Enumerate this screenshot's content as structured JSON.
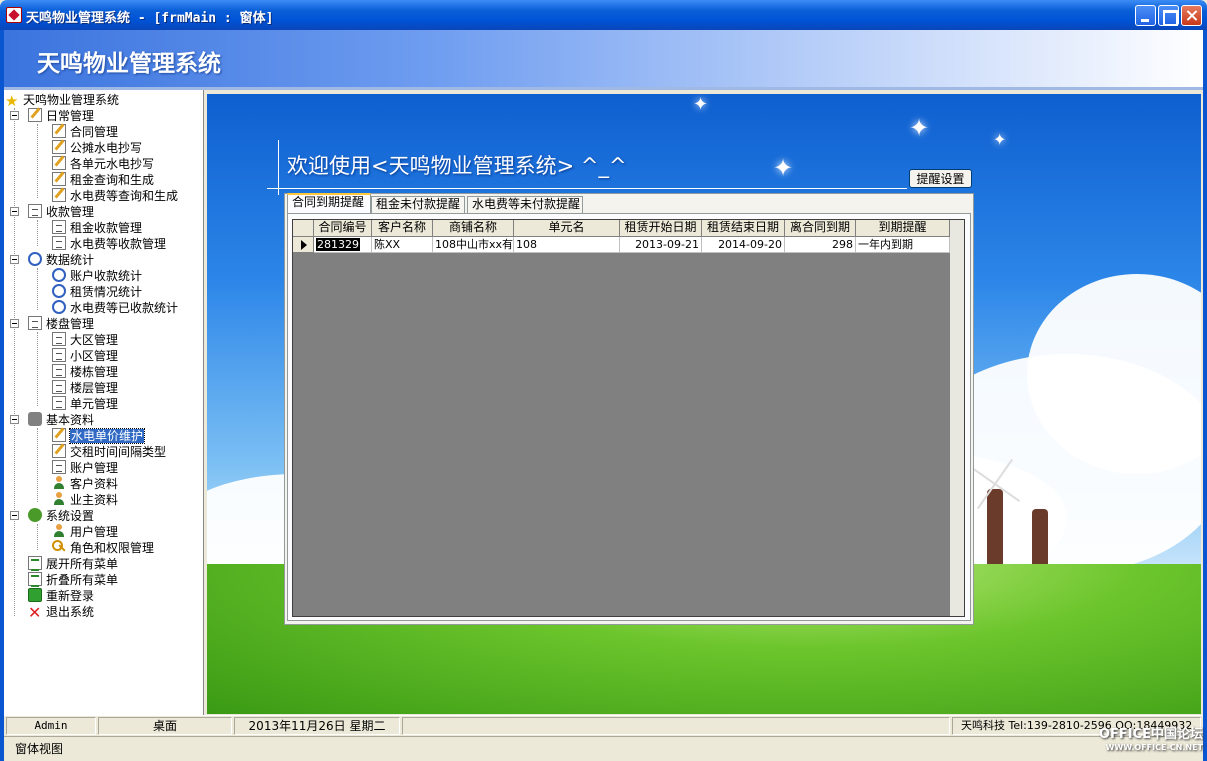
{
  "window": {
    "title": "天鸣物业管理系统 - [frmMain : 窗体]"
  },
  "banner": {
    "title": "天鸣物业管理系统"
  },
  "tree": {
    "root": "天鸣物业管理系统",
    "groups": [
      {
        "label": "日常管理",
        "items": [
          "合同管理",
          "公摊水电抄写",
          "各单元水电抄写",
          "租金查询和生成",
          "水电费等查询和生成"
        ]
      },
      {
        "label": "收款管理",
        "items": [
          "租金收款管理",
          "水电费等收款管理"
        ]
      },
      {
        "label": "数据统计",
        "items": [
          "账户收款统计",
          "租赁情况统计",
          "水电费等已收款统计"
        ]
      },
      {
        "label": "楼盘管理",
        "items": [
          "大区管理",
          "小区管理",
          "楼栋管理",
          "楼层管理",
          "单元管理"
        ]
      },
      {
        "label": "基本资料",
        "items": [
          "水电单价维护",
          "交租时间间隔类型",
          "账户管理",
          "客户资料",
          "业主资料"
        ]
      },
      {
        "label": "系统设置",
        "items": [
          "用户管理",
          "角色和权限管理"
        ]
      }
    ],
    "actions": [
      "展开所有菜单",
      "折叠所有菜单",
      "重新登录",
      "退出系统"
    ],
    "selected_item": "水电单价维护"
  },
  "main": {
    "welcome": "欢迎使用<天鸣物业管理系统> ^_^",
    "remind_button": "提醒设置",
    "tabs": [
      "合同到期提醒",
      "租金未付款提醒",
      "水电费等未付款提醒"
    ],
    "active_tab": 0,
    "grid": {
      "columns": [
        "合同编号",
        "客户名称",
        "商铺名称",
        "单元名",
        "租赁开始日期",
        "租赁结束日期",
        "离合同到期",
        "到期提醒"
      ],
      "rows": [
        [
          "281329",
          "陈XX",
          "108中山市xx有",
          "108",
          "2013-09-21",
          "2014-09-20",
          "298",
          "一年内到期"
        ]
      ]
    }
  },
  "statusbar": {
    "user": "Admin",
    "location": "桌面",
    "date": "2013年11月26日 星期二",
    "company": "天鸣科技 Tel:139-2810-2596 QQ:18449932"
  },
  "footer": {
    "view": "窗体视图"
  },
  "watermark": {
    "line1": "OFFICE中国论坛",
    "line2": "WWW.OFFICE-CN.NET"
  }
}
